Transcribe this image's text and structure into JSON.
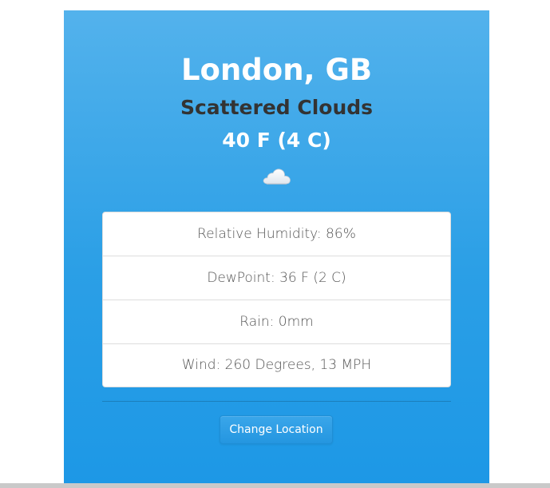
{
  "location": {
    "title": "London, GB"
  },
  "weather": {
    "conditions": "Scattered Clouds",
    "temperature": "40 F (4 C)",
    "icon": "cloud-icon"
  },
  "details": [
    {
      "label": "Relative Humidity: 86%"
    },
    {
      "label": "DewPoint: 36 F (2 C)"
    },
    {
      "label": "Rain: 0mm"
    },
    {
      "label": "Wind: 260 Degrees, 13 MPH"
    }
  ],
  "actions": {
    "change_location_label": "Change Location"
  },
  "colors": {
    "card_background": "#2b9fe6",
    "conditions_text": "#333333",
    "primary_text": "#ffffff",
    "button": "#2496e0"
  }
}
